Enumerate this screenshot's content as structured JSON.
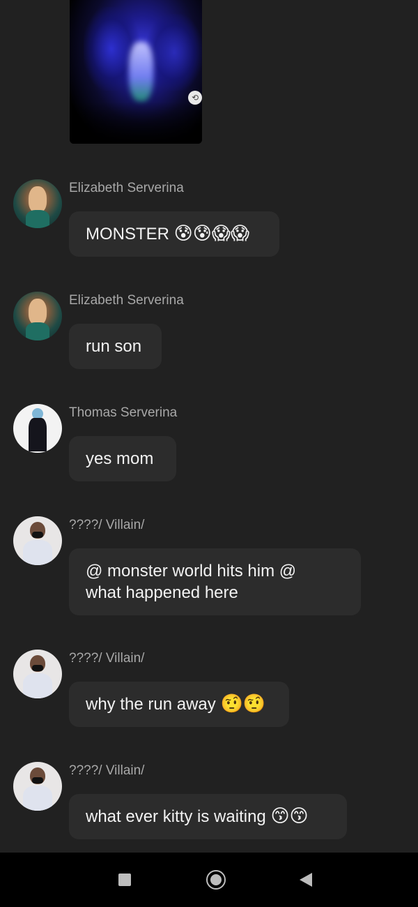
{
  "shared_image": {
    "icon": "share-icon"
  },
  "messages": [
    {
      "sender": "Elizabeth Serverina",
      "avatar": "elizabeth",
      "text": "MONSTER",
      "emoji": "😰😰😱😱"
    },
    {
      "sender": "Elizabeth Serverina",
      "avatar": "elizabeth",
      "text": "run son",
      "emoji": ""
    },
    {
      "sender": "Thomas Serverina",
      "avatar": "thomas",
      "text": "yes mom",
      "emoji": ""
    },
    {
      "sender": "????/ Villain/",
      "avatar": "villain",
      "text_line1": "@ monster world hits him @",
      "text_line2": "what happened here"
    },
    {
      "sender": "????/ Villain/",
      "avatar": "villain",
      "text": "why the run away",
      "emoji": "🤨🤨"
    },
    {
      "sender": "????/ Villain/",
      "avatar": "villain",
      "text": "what ever kitty is waiting",
      "emoji": "😙😙"
    }
  ],
  "navbar": {
    "recents_icon": "square-icon",
    "home_icon": "circle-icon",
    "back_icon": "triangle-back-icon"
  }
}
